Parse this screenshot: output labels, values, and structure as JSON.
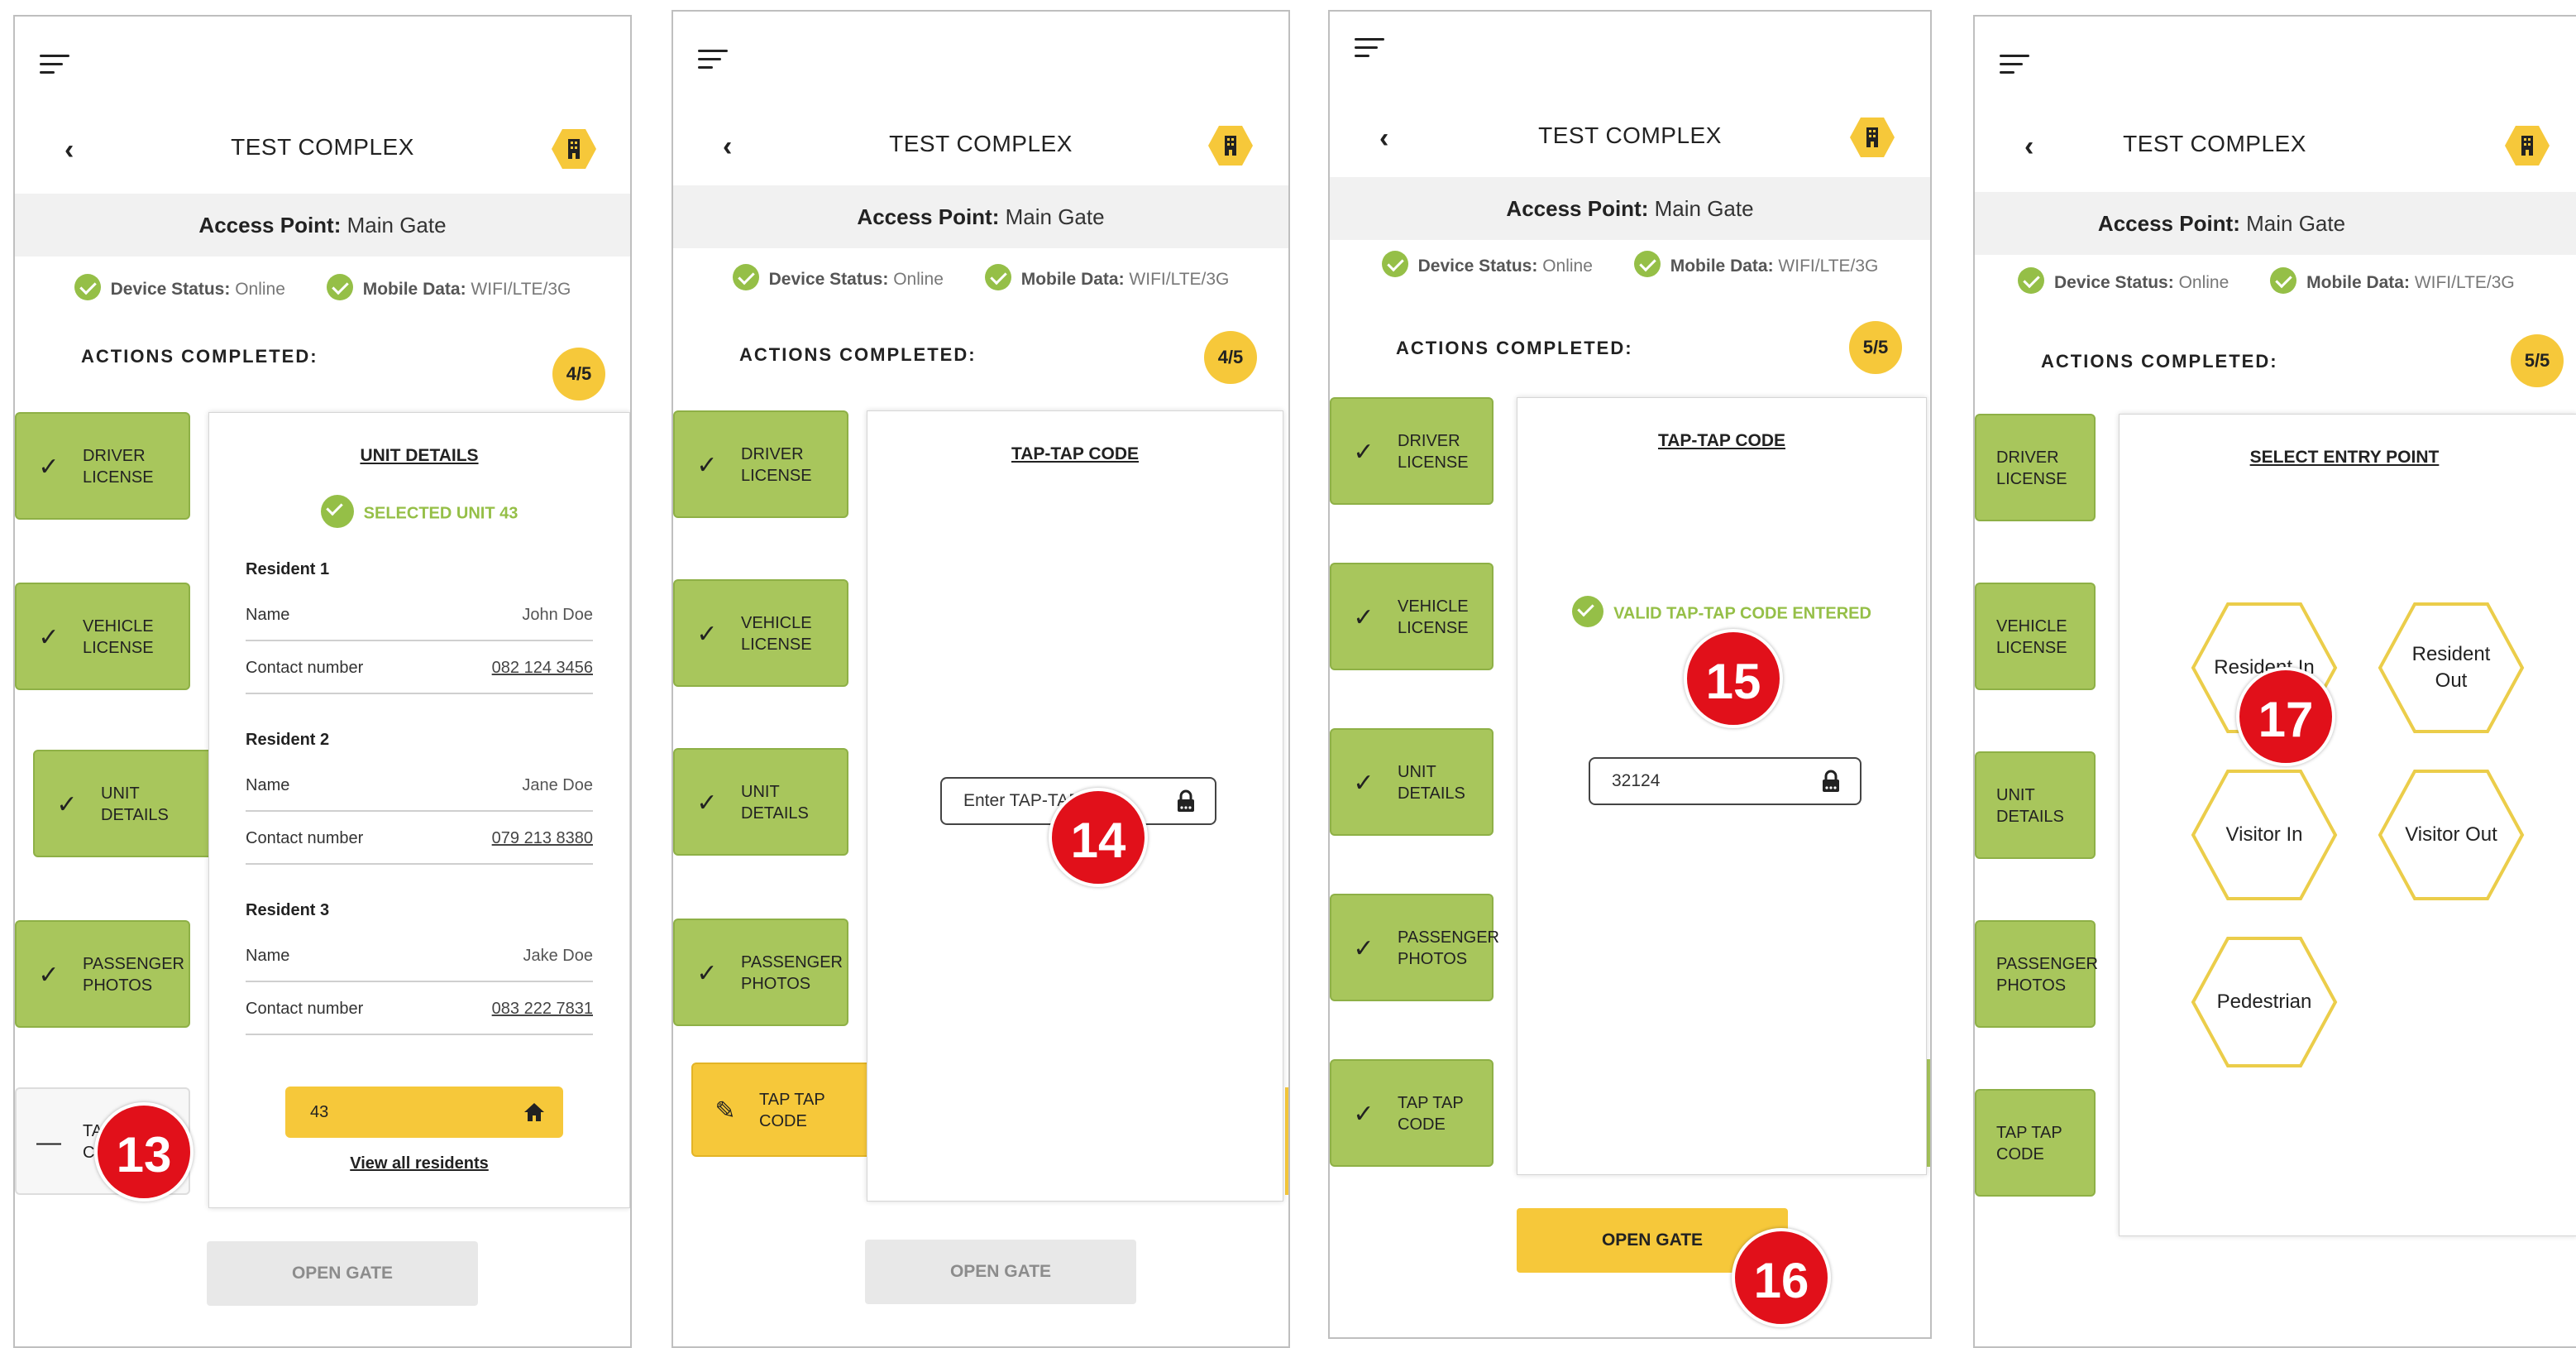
{
  "app": {
    "title": "TEST COMPLEX",
    "access_label": "Access Point:",
    "access_value": "Main Gate",
    "device_status_label": "Device Status:",
    "device_status_value": "Online",
    "mobile_data_label": "Mobile Data:",
    "mobile_data_value": "WIFI/LTE/3G",
    "actions_label": "ACTIONS COMPLETED:",
    "open_gate_label": "OPEN GATE"
  },
  "colors": {
    "accent_green": "#a8c65c",
    "check_green": "#95bf47",
    "accent_yellow": "#f6c83a",
    "marker_red": "#e1101a"
  },
  "screens": [
    {
      "actions_count": "4/5",
      "cards": [
        "DRIVER LICENSE",
        "VEHICLE LICENSE",
        "UNIT DETAILS",
        "PASSENGER PHOTOS",
        "TAP TAP CODE"
      ],
      "panel_title": "UNIT DETAILS",
      "selected_unit": "SELECTED UNIT 43",
      "residents": [
        {
          "title": "Resident 1",
          "name_label": "Name",
          "name": "John Doe",
          "contact_label": "Contact number",
          "contact": "082 124 3456"
        },
        {
          "title": "Resident 2",
          "name_label": "Name",
          "name": "Jane Doe",
          "contact_label": "Contact number",
          "contact": "079 213 8380"
        },
        {
          "title": "Resident 3",
          "name_label": "Name",
          "name": "Jake Doe",
          "contact_label": "Contact number",
          "contact": "083 222 7831"
        }
      ],
      "unit_value": "43",
      "view_all": "View all residents",
      "marker": "13"
    },
    {
      "actions_count": "4/5",
      "cards": [
        "DRIVER LICENSE",
        "VEHICLE LICENSE",
        "UNIT DETAILS",
        "PASSENGER PHOTOS",
        "TAP TAP CODE"
      ],
      "panel_title": "TAP-TAP CODE",
      "code_placeholder": "Enter TAP-TAP code",
      "marker": "14"
    },
    {
      "actions_count": "5/5",
      "cards": [
        "DRIVER LICENSE",
        "VEHICLE LICENSE",
        "UNIT DETAILS",
        "PASSENGER PHOTOS",
        "TAP TAP CODE"
      ],
      "panel_title": "TAP-TAP CODE",
      "valid_message": "VALID TAP-TAP CODE ENTERED",
      "code_value": "32124",
      "marker_valid": "15",
      "marker_gate": "16"
    },
    {
      "actions_count": "5/5",
      "cards": [
        "DRIVER LICENSE",
        "VEHICLE LICENSE",
        "UNIT DETAILS",
        "PASSENGER PHOTOS",
        "TAP TAP CODE"
      ],
      "panel_title": "SELECT ENTRY POINT",
      "entry_points": [
        "Resident In",
        "Resident Out",
        "Visitor In",
        "Visitor Out",
        "Pedestrian"
      ],
      "marker": "17"
    }
  ]
}
